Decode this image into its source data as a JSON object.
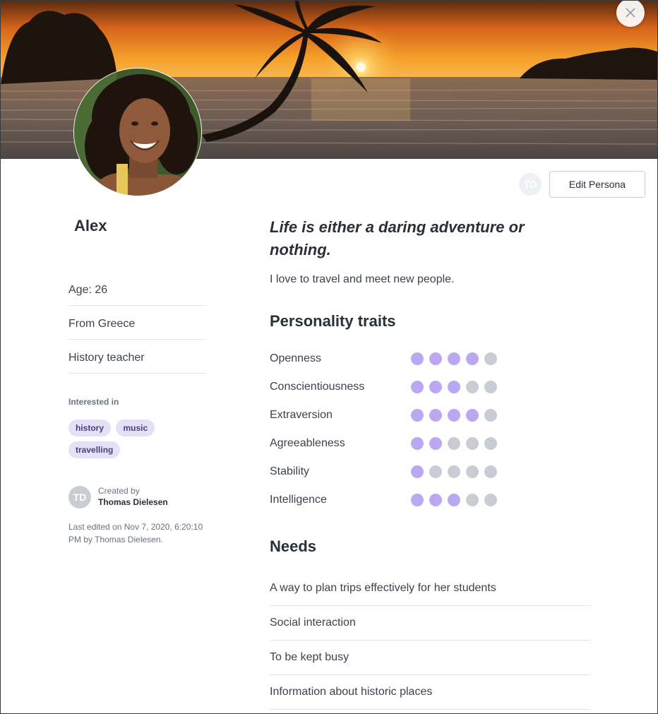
{
  "header": {
    "close_icon": "close-icon",
    "edit_button_label": "Edit Persona",
    "user_initials": "TD"
  },
  "persona": {
    "name": "Alex",
    "facts": [
      "Age: 26",
      "From Greece",
      "History teacher"
    ],
    "interested_label": "Interested in",
    "interests": [
      "history",
      "music",
      "travelling"
    ],
    "quote": "Life is either a daring adventure or nothing.",
    "bio": "I love to travel and meet new people."
  },
  "creator": {
    "initials": "TD",
    "created_by_label": "Created by",
    "name": "Thomas Dielesen",
    "last_edited": "Last edited on Nov 7, 2020, 6:20:10 PM by Thomas Dielesen."
  },
  "personality": {
    "title": "Personality traits",
    "max": 5,
    "traits": [
      {
        "name": "Openness",
        "level": 4
      },
      {
        "name": "Conscientiousness",
        "level": 3
      },
      {
        "name": "Extraversion",
        "level": 4
      },
      {
        "name": "Agreeableness",
        "level": 2
      },
      {
        "name": "Stability",
        "level": 1
      },
      {
        "name": "Intelligence",
        "level": 3
      }
    ],
    "active_color": "#bba8f0",
    "inactive_color": "#c8ccd3"
  },
  "needs": {
    "title": "Needs",
    "items": [
      "A way to plan trips effectively for her students",
      "Social interaction",
      "To be kept busy",
      "Information about historic places"
    ]
  }
}
